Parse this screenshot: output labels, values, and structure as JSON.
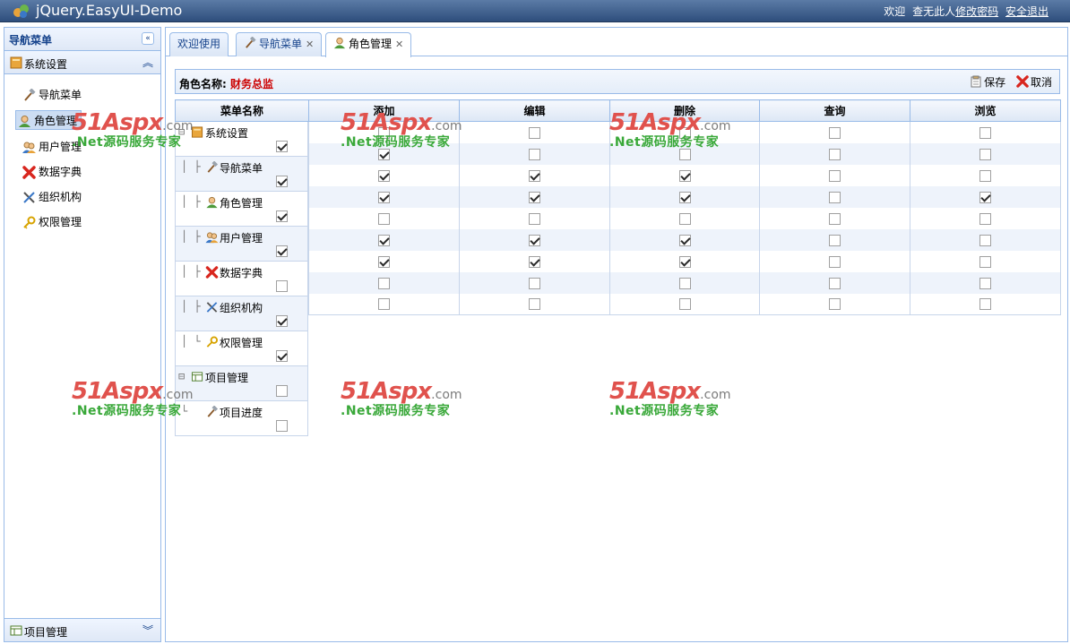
{
  "app": {
    "title": "jQuery.EasyUI-Demo",
    "welcome": "欢迎",
    "user": "查无此人",
    "change_password": "修改密码",
    "logout": "安全退出"
  },
  "nav": {
    "title": "导航菜单",
    "groups": [
      {
        "label": "系统设置",
        "icon": "folder-icon"
      },
      {
        "label": "项目管理",
        "icon": "project-icon"
      }
    ],
    "items": [
      {
        "label": "导航菜单",
        "icon": "hammer-icon"
      },
      {
        "label": "角色管理",
        "icon": "person-icon",
        "selected": true
      },
      {
        "label": "用户管理",
        "icon": "users-icon"
      },
      {
        "label": "数据字典",
        "icon": "red-x-icon"
      },
      {
        "label": "组织机构",
        "icon": "tools-icon"
      },
      {
        "label": "权限管理",
        "icon": "key-icon"
      }
    ]
  },
  "tabs": [
    {
      "label": "欢迎使用",
      "closable": false
    },
    {
      "label": "导航菜单",
      "closable": true,
      "icon": "hammer-icon"
    },
    {
      "label": "角色管理",
      "closable": true,
      "icon": "person-icon",
      "active": true
    }
  ],
  "role": {
    "label": "角色名称:",
    "name": "财务总监",
    "save_label": "保存",
    "cancel_label": "取消"
  },
  "grid": {
    "columns": [
      "菜单名称",
      "添加",
      "编辑",
      "删除",
      "查询",
      "浏览"
    ],
    "rows": [
      {
        "name": "系统设置",
        "level": 0,
        "icon": "folder-icon",
        "menu": true,
        "perms": [
          false,
          false,
          false,
          false,
          false
        ]
      },
      {
        "name": "导航菜单",
        "level": 1,
        "icon": "hammer-icon",
        "menu": true,
        "perms": [
          true,
          false,
          false,
          false,
          false
        ]
      },
      {
        "name": "角色管理",
        "level": 1,
        "icon": "person-icon",
        "menu": true,
        "perms": [
          true,
          true,
          true,
          false,
          false
        ]
      },
      {
        "name": "用户管理",
        "level": 1,
        "icon": "users-icon",
        "menu": true,
        "perms": [
          true,
          true,
          true,
          false,
          true
        ]
      },
      {
        "name": "数据字典",
        "level": 1,
        "icon": "red-x-icon",
        "menu": false,
        "perms": [
          false,
          false,
          false,
          false,
          false
        ]
      },
      {
        "name": "组织机构",
        "level": 1,
        "icon": "tools-icon",
        "menu": true,
        "perms": [
          true,
          true,
          true,
          false,
          false
        ]
      },
      {
        "name": "权限管理",
        "level": 1,
        "icon": "key-icon",
        "menu": true,
        "perms": [
          true,
          true,
          true,
          false,
          false
        ]
      },
      {
        "name": "项目管理",
        "level": 0,
        "icon": "project-icon",
        "menu": false,
        "perms": [
          false,
          false,
          false,
          false,
          false
        ]
      },
      {
        "name": "项目进度",
        "level": 1,
        "icon": "hammer-icon",
        "menu": false,
        "perms": [
          false,
          false,
          false,
          false,
          false
        ]
      }
    ]
  },
  "watermark": {
    "brand": "51Aspx",
    "suffix": ".com",
    "tagline": ".Net源码服务专家"
  },
  "colors": {
    "header": "#2e4e7c",
    "border": "#99bbe8",
    "role_name": "#cc0000"
  }
}
